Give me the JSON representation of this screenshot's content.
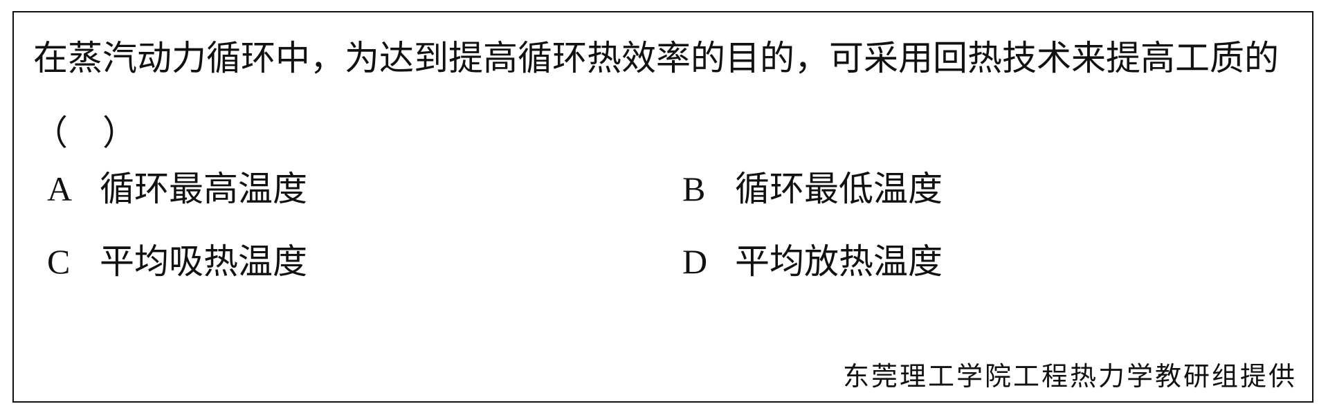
{
  "question": {
    "text": "在蒸汽动力循环中，为达到提高循环热效率的目的，可采用回热技术来提高工质的（　）"
  },
  "options": [
    {
      "letter": "A",
      "text": "循环最高温度"
    },
    {
      "letter": "B",
      "text": "循环最低温度"
    },
    {
      "letter": "C",
      "text": "平均吸热温度"
    },
    {
      "letter": "D",
      "text": "平均放热温度"
    }
  ],
  "footer": {
    "text": "东莞理工学院工程热力学教研组提供"
  }
}
